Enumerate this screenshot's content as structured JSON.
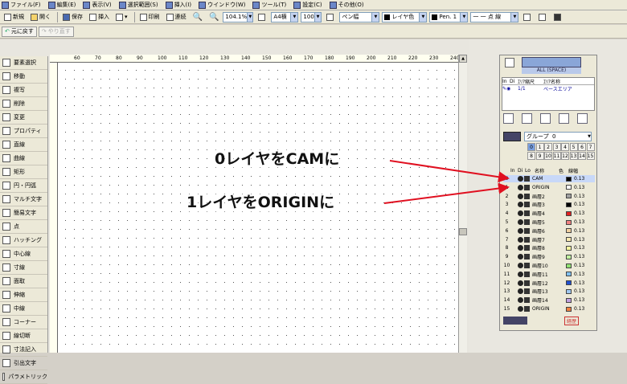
{
  "menu": [
    {
      "name": "menu-file",
      "label": "ファイル(F)"
    },
    {
      "name": "menu-edit",
      "label": "編集(E)"
    },
    {
      "name": "menu-view",
      "label": "表示(V)"
    },
    {
      "name": "menu-select-range",
      "label": "選択範囲(S)"
    },
    {
      "name": "menu-insert",
      "label": "挿入(I)"
    },
    {
      "name": "menu-window",
      "label": "ウインドウ(W)"
    },
    {
      "name": "menu-tool",
      "label": "ツール(T)"
    },
    {
      "name": "menu-settings",
      "label": "設定(C)"
    },
    {
      "name": "menu-other",
      "label": "その他(O)"
    }
  ],
  "toolbar": {
    "new": "新規",
    "open": "開く",
    "save": "保存",
    "insert": "挿入",
    "print": "印刷",
    "continuous": "連続",
    "zoom": "104.1%",
    "paper": "A4横",
    "scale": "100",
    "pen_width": "ペン幅",
    "layer_color": "レイヤ色",
    "pen": "Pen. 1",
    "line_type": "一 一 点 線"
  },
  "toolbar2": {
    "undo": "元に戻す",
    "redo": "やり直す"
  },
  "ruler": {
    "ticks": [
      "60",
      "70",
      "80",
      "90",
      "100",
      "110",
      "120",
      "130",
      "140",
      "150",
      "160",
      "170",
      "180",
      "190",
      "200",
      "210",
      "220",
      "230",
      "240"
    ]
  },
  "tools": [
    {
      "name": "tool-select",
      "label": "要素選択"
    },
    {
      "name": "tool-move",
      "label": "移動"
    },
    {
      "name": "tool-copy",
      "label": "複写"
    },
    {
      "name": "tool-delete",
      "label": "削除"
    },
    {
      "name": "tool-change",
      "label": "変更"
    },
    {
      "name": "tool-property",
      "label": "プロパティ"
    },
    {
      "name": "tool-line",
      "label": "直線"
    },
    {
      "name": "tool-curve",
      "label": "曲線"
    },
    {
      "name": "tool-rect",
      "label": "矩形"
    },
    {
      "name": "tool-circle",
      "label": "円・円弧"
    },
    {
      "name": "tool-multitext",
      "label": "マルチ文字"
    },
    {
      "name": "tool-simpletext",
      "label": "簡易文字"
    },
    {
      "name": "tool-point",
      "label": "点"
    },
    {
      "name": "tool-hatching",
      "label": "ハッチング"
    },
    {
      "name": "tool-centerline",
      "label": "中心線"
    },
    {
      "name": "tool-offsetline",
      "label": "寸線"
    },
    {
      "name": "tool-chamfer",
      "label": "面取"
    },
    {
      "name": "tool-trim",
      "label": "伸縮"
    },
    {
      "name": "tool-middleline",
      "label": "中線"
    },
    {
      "name": "tool-corner",
      "label": "コーナー"
    },
    {
      "name": "tool-cut",
      "label": "線切断"
    },
    {
      "name": "tool-dimension",
      "label": "寸法記入"
    },
    {
      "name": "tool-leader",
      "label": "引出文字"
    },
    {
      "name": "tool-parametric",
      "label": "パラメトリック"
    }
  ],
  "panel": {
    "all_space": "ALL (SPACE)",
    "area_headers": [
      "In",
      "Di",
      "ｴﾘｱ縮尺",
      "ｴﾘｱ名称"
    ],
    "area_row": {
      "scale": "1/1",
      "name": "ベースエリア"
    },
    "group_label": "グループ",
    "group_value": "0",
    "group_tabs": [
      "0",
      "1",
      "2",
      "3",
      "4",
      "5",
      "6",
      "7",
      "8",
      "9",
      "10",
      "11",
      "12",
      "13",
      "14",
      "15"
    ],
    "layer_headers": [
      "In",
      "Di",
      "Lo",
      "名称",
      "色",
      "線幅"
    ],
    "footer_label": "経歴"
  },
  "layers": [
    {
      "num": "0",
      "name": "CAM",
      "color": "#000000",
      "width": "0.13"
    },
    {
      "num": "1",
      "name": "ORIGIN",
      "color": "#ffffff",
      "width": "0.13"
    },
    {
      "num": "2",
      "name": "画層2",
      "color": "#a0a0a0",
      "width": "0.13"
    },
    {
      "num": "3",
      "name": "画層3",
      "color": "#000000",
      "width": "0.13"
    },
    {
      "num": "4",
      "name": "画層4",
      "color": "#e02020",
      "width": "0.13"
    },
    {
      "num": "5",
      "name": "画層5",
      "color": "#f08080",
      "width": "0.13"
    },
    {
      "num": "6",
      "name": "画層6",
      "color": "#f0d0a0",
      "width": "0.13"
    },
    {
      "num": "7",
      "name": "画層7",
      "color": "#f8e8b0",
      "width": "0.13"
    },
    {
      "num": "8",
      "name": "画層8",
      "color": "#f8f8a0",
      "width": "0.13"
    },
    {
      "num": "9",
      "name": "画層9",
      "color": "#c0f0a0",
      "width": "0.13"
    },
    {
      "num": "10",
      "name": "画層10",
      "color": "#90e070",
      "width": "0.13"
    },
    {
      "num": "11",
      "name": "画層11",
      "color": "#80c0f0",
      "width": "0.13"
    },
    {
      "num": "12",
      "name": "画層12",
      "color": "#2050d0",
      "width": "0.13"
    },
    {
      "num": "13",
      "name": "画層13",
      "color": "#a0c8f0",
      "width": "0.13"
    },
    {
      "num": "14",
      "name": "画層14",
      "color": "#c0a0e0",
      "width": "0.13"
    },
    {
      "num": "15",
      "name": "ORIGIN",
      "color": "#f08040",
      "width": "0.13"
    }
  ],
  "annotations": {
    "callout0": "0レイヤをCAMに",
    "callout1": "1レイヤをORIGINに",
    "arrow_color": "#e01020"
  }
}
